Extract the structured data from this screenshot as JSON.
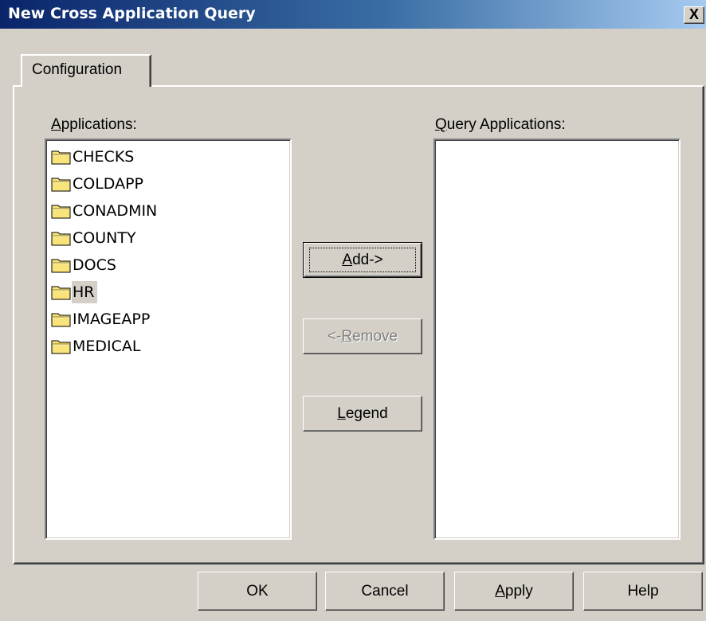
{
  "window": {
    "title": "New Cross Application Query",
    "close_glyph": "X"
  },
  "tabs": [
    {
      "label": "Configuration",
      "selected": true
    }
  ],
  "applications": {
    "label_mnemonic": "A",
    "label_rest": "pplications:",
    "items": [
      {
        "label": "CHECKS",
        "icon": "folder-icon",
        "selected": false
      },
      {
        "label": "COLDAPP",
        "icon": "folder-icon",
        "selected": false
      },
      {
        "label": "CONADMIN",
        "icon": "folder-icon",
        "selected": false
      },
      {
        "label": "COUNTY",
        "icon": "folder-icon",
        "selected": false
      },
      {
        "label": "DOCS",
        "icon": "folder-icon",
        "selected": false
      },
      {
        "label": "HR",
        "icon": "folder-icon",
        "selected": true
      },
      {
        "label": "IMAGEAPP",
        "icon": "folder-icon",
        "selected": false
      },
      {
        "label": "MEDICAL",
        "icon": "folder-icon",
        "selected": false
      }
    ]
  },
  "query_applications": {
    "label_mnemonic": "Q",
    "label_rest": "uery Applications:",
    "items": []
  },
  "buttons": {
    "add": {
      "mnemonic": "A",
      "rest": "dd->",
      "enabled": true,
      "default": true
    },
    "remove": {
      "prefix": "<-",
      "mnemonic": "R",
      "rest": "emove",
      "enabled": false
    },
    "legend": {
      "mnemonic": "L",
      "rest": "egend",
      "enabled": true
    }
  },
  "footer": {
    "ok": "OK",
    "cancel": "Cancel",
    "apply_mnemonic": "A",
    "apply_rest": "pply",
    "help": "Help"
  },
  "colors": {
    "title_start": "#0a246a",
    "title_end": "#a6caf0",
    "face": "#d4d0c8",
    "folder": "#f8e47a"
  }
}
